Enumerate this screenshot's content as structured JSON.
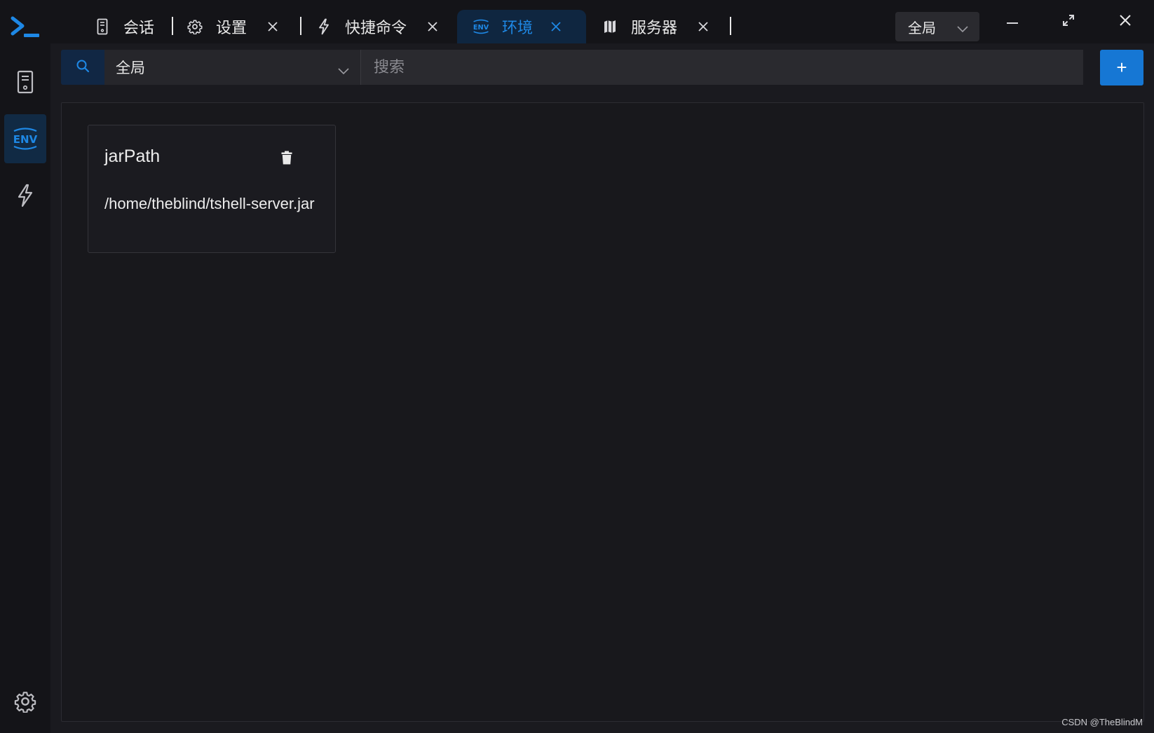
{
  "rail": {
    "logo_icon": "terminal-prompt-icon",
    "items": [
      {
        "id": "sessions",
        "icon": "server-icon",
        "active": false
      },
      {
        "id": "environments",
        "icon": "env-icon",
        "active": true
      },
      {
        "id": "quick-commands",
        "icon": "lightning-icon",
        "active": false
      }
    ],
    "settings_icon": "gear-icon"
  },
  "tabs": [
    {
      "label": "会话",
      "icon": "server-icon",
      "closable": false,
      "active": false
    },
    {
      "label": "设置",
      "icon": "gear-icon",
      "closable": true,
      "active": false
    },
    {
      "label": "快捷命令",
      "icon": "lightning-icon",
      "closable": true,
      "active": false
    },
    {
      "label": "环境",
      "icon": "env-icon",
      "closable": true,
      "active": true
    },
    {
      "label": "服务器",
      "icon": "map-icon",
      "closable": true,
      "active": false
    }
  ],
  "tab_close_glyph": "X",
  "scope_selector": {
    "value": "全局"
  },
  "window_controls": {
    "minimize": "minimize-icon",
    "fullscreen": "expand-icon",
    "close": "close-icon"
  },
  "filter": {
    "scope_value": "全局",
    "search_placeholder": "搜索",
    "add_label": "+"
  },
  "env_cards": [
    {
      "name": "jarPath",
      "value": "/home/theblind/tshell-server.jar"
    }
  ],
  "watermark": "CSDN @TheBlindM",
  "colors": {
    "accent": "#1677d4",
    "active_tab_bg": "#0f2640",
    "background": "#1a1a1f"
  }
}
